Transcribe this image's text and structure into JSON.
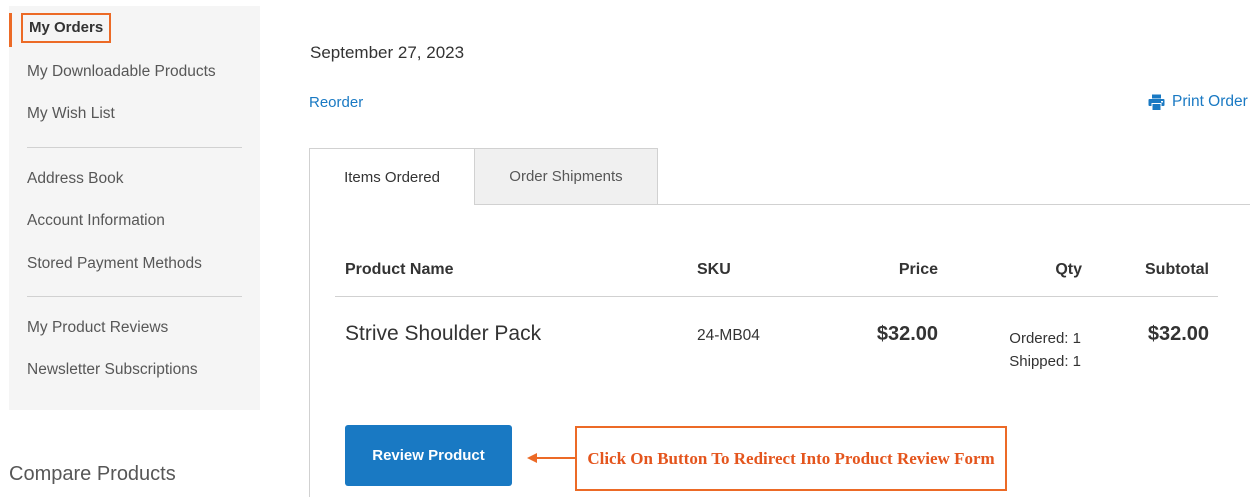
{
  "sidebar": {
    "active_item": "My Orders",
    "items_group1": [
      "My Downloadable Products",
      "My Wish List"
    ],
    "items_group2": [
      "Address Book",
      "Account Information",
      "Stored Payment Methods"
    ],
    "items_group3": [
      "My Product Reviews",
      "Newsletter Subscriptions"
    ]
  },
  "compare": {
    "title": "Compare Products"
  },
  "order": {
    "date": "September 27, 2023",
    "reorder_label": "Reorder",
    "print_label": "Print Order"
  },
  "tabs": [
    "Items Ordered",
    "Order Shipments"
  ],
  "table": {
    "headers": [
      "Product Name",
      "SKU",
      "Price",
      "Qty",
      "Subtotal"
    ],
    "rows": [
      {
        "name": "Strive Shoulder Pack",
        "sku": "24-MB04",
        "price": "$32.00",
        "qty_ordered": "Ordered: 1",
        "qty_shipped": "Shipped: 1",
        "subtotal": "$32.00"
      }
    ]
  },
  "review_button": "Review Product",
  "annotation": {
    "text": "Click On Button To Redirect Into Product Review Form",
    "color": "#ec6a26"
  },
  "colors": {
    "accent": "#1979c3",
    "highlight": "#ec6a26"
  },
  "icons": {
    "print": "printer-icon"
  }
}
